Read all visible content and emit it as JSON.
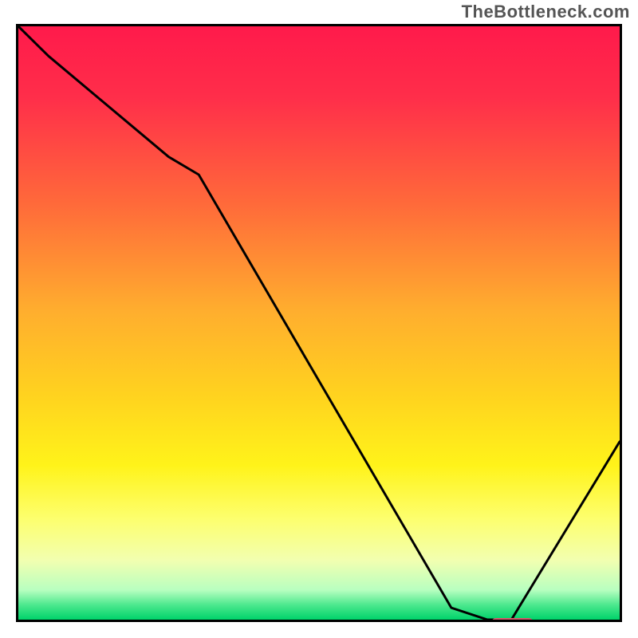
{
  "watermark": "TheBottleneck.com",
  "chart_data": {
    "type": "line",
    "title": "",
    "xlabel": "",
    "ylabel": "",
    "xlim": [
      0,
      100
    ],
    "ylim": [
      0,
      100
    ],
    "grid": false,
    "x": [
      0,
      5,
      25,
      30,
      72,
      78,
      82,
      100
    ],
    "values": [
      100,
      95,
      78,
      75,
      2,
      0,
      0,
      30
    ],
    "marker": {
      "x_start": 78,
      "x_end": 85,
      "y": 0
    },
    "gradient_stops": [
      {
        "pos": 0.0,
        "color": "#ff1a4b"
      },
      {
        "pos": 0.12,
        "color": "#ff2e4a"
      },
      {
        "pos": 0.3,
        "color": "#ff6a3a"
      },
      {
        "pos": 0.48,
        "color": "#ffae2e"
      },
      {
        "pos": 0.62,
        "color": "#ffd21f"
      },
      {
        "pos": 0.74,
        "color": "#fff31a"
      },
      {
        "pos": 0.83,
        "color": "#fdff6e"
      },
      {
        "pos": 0.9,
        "color": "#f2ffb0"
      },
      {
        "pos": 0.95,
        "color": "#b8ffc0"
      },
      {
        "pos": 0.975,
        "color": "#4de88e"
      },
      {
        "pos": 1.0,
        "color": "#00d36a"
      }
    ]
  }
}
